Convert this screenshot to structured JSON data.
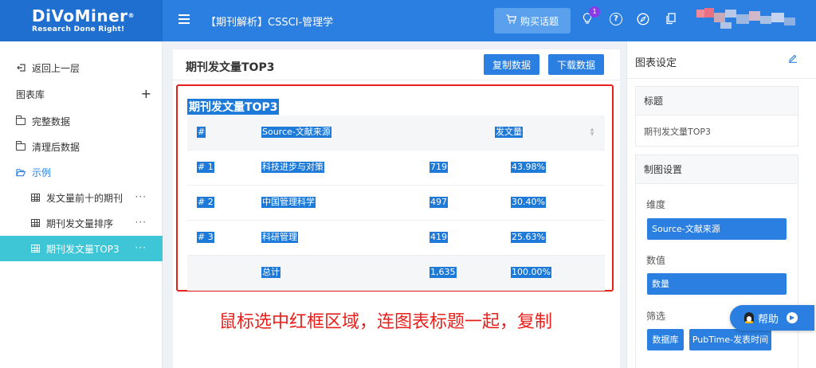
{
  "app": {
    "logo_text": "DiVoMiner",
    "logo_tagline": "Research Done Right!",
    "page_title": "【期刊解析】CSSCI-管理学",
    "buy_button": "购买话题",
    "notification_count": "1"
  },
  "sidebar": {
    "back": "返回上一层",
    "library": "图表库",
    "items": [
      {
        "label": "完整数据",
        "icon": "folder-icon"
      },
      {
        "label": "清理后数据",
        "icon": "folder-icon"
      },
      {
        "label": "示例",
        "icon": "folder-open-icon"
      }
    ],
    "charts": [
      {
        "label": "发文量前十的期刊",
        "icon": "table-icon"
      },
      {
        "label": "期刊发文量排序",
        "icon": "table-icon"
      },
      {
        "label": "期刊发文量TOP3",
        "icon": "table-icon"
      }
    ],
    "more": "···"
  },
  "main": {
    "title": "期刊发文量TOP3",
    "copy_button": "复制数据",
    "download_button": "下载数据",
    "chart_title": "期刊发文量TOP3",
    "table": {
      "headers": [
        "#",
        "Source-文献来源",
        "发文量"
      ],
      "rows": [
        [
          "# 1",
          "科技进步与对策",
          "719",
          "43.98%"
        ],
        [
          "# 2",
          "中国管理科学",
          "497",
          "30.40%"
        ],
        [
          "# 3",
          "科研管理",
          "419",
          "25.63%"
        ]
      ],
      "total": [
        "",
        "总计",
        "1,635",
        "100.00%"
      ]
    },
    "note": "鼠标选中红框区域，连图表标题一起，复制"
  },
  "right_panel": {
    "title": "图表设定",
    "title_section": "标题",
    "title_value": "期刊发文量TOP3",
    "chart_settings": "制图设置",
    "dimension_label": "维度",
    "dimension_value": "Source-文献来源",
    "value_label": "数值",
    "value_value": "数量",
    "filter_label": "筛选",
    "filter_chips": [
      "数据库",
      "PubTime-发表时间"
    ]
  },
  "help": {
    "label": "帮助"
  },
  "colors": {
    "primary": "#2b7fe0",
    "active_sidebar": "#3ec6d6",
    "selection": "#1e7ad8",
    "annotation_red": "#e8201c"
  }
}
